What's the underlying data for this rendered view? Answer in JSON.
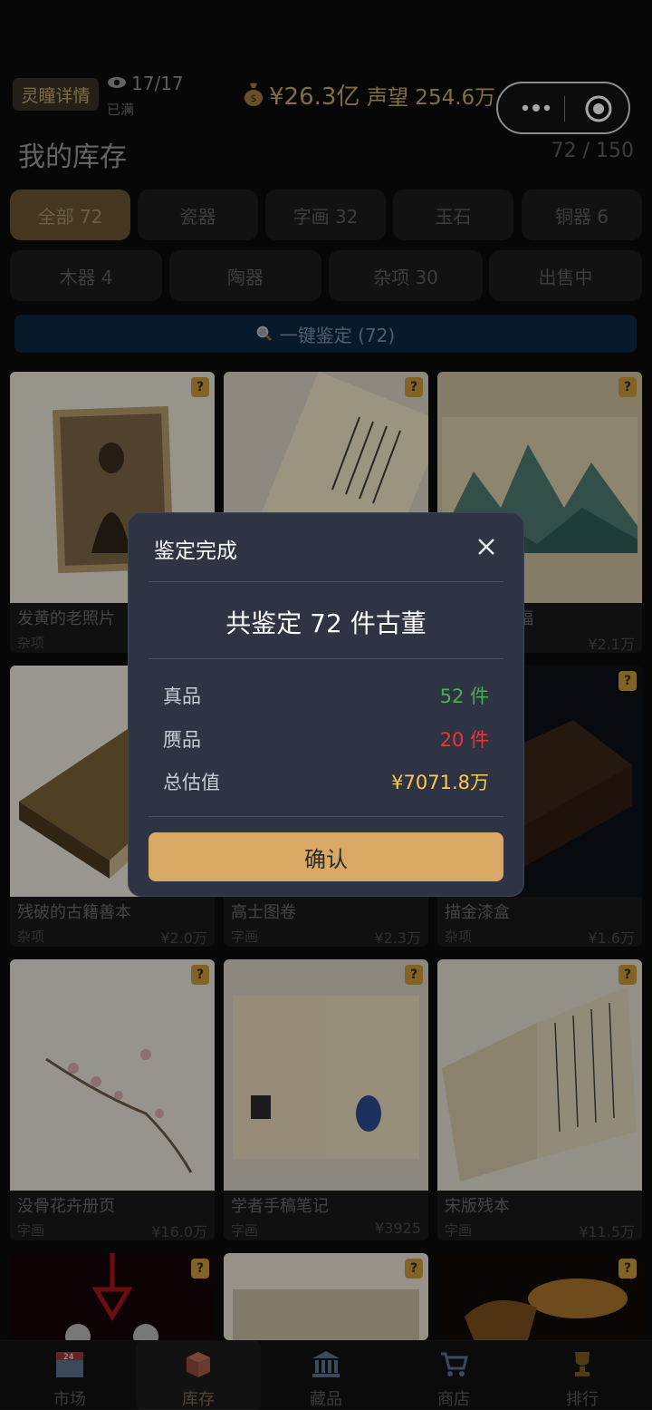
{
  "header": {
    "tag_label": "灵瞳详情",
    "views": "17/17",
    "views_sub": "已满",
    "money": "¥26.3亿",
    "reputation": "声望 254.6万"
  },
  "inventory": {
    "title": "我的库存",
    "count": "72 / 150"
  },
  "tabs_row1": [
    {
      "label": "全部 72",
      "active": true
    },
    {
      "label": "瓷器"
    },
    {
      "label": "字画 32"
    },
    {
      "label": "玉石"
    },
    {
      "label": "铜器 6"
    }
  ],
  "tabs_row2": [
    {
      "label": "木器 4"
    },
    {
      "label": "陶器"
    },
    {
      "label": "杂项 30"
    },
    {
      "label": "出售中"
    }
  ],
  "identify_all": {
    "icon": "search-icon",
    "label": "一键鉴定 (72)"
  },
  "items": [
    {
      "name": "发黄的老照片",
      "category": "杂项",
      "price": "",
      "badge": "?"
    },
    {
      "name": "",
      "category": "",
      "price": "",
      "badge": "?"
    },
    {
      "name": "幅",
      "category": "",
      "price": "¥2.1万",
      "badge": "?"
    },
    {
      "name": "残破的古籍善本",
      "category": "杂项",
      "price": "¥2.0万",
      "badge": "?"
    },
    {
      "name": "高士图卷",
      "category": "字画",
      "price": "¥2.3万",
      "badge": "?"
    },
    {
      "name": "描金漆盒",
      "category": "杂项",
      "price": "¥1.6万",
      "badge": "?"
    },
    {
      "name": "没骨花卉册页",
      "category": "字画",
      "price": "¥16.0万",
      "badge": "?"
    },
    {
      "name": "学者手稿笔记",
      "category": "字画",
      "price": "¥3925",
      "badge": "?"
    },
    {
      "name": "宋版残本",
      "category": "字画",
      "price": "¥11.5万",
      "badge": "?"
    },
    {
      "name": "",
      "category": "",
      "price": "",
      "badge": "?"
    },
    {
      "name": "",
      "category": "",
      "price": "",
      "badge": "?"
    },
    {
      "name": "",
      "category": "",
      "price": "",
      "badge": "?"
    }
  ],
  "modal": {
    "title": "鉴定完成",
    "headline": "共鉴定 72 件古董",
    "rows": [
      {
        "label": "真品",
        "value": "52 件",
        "color": "#4caf50"
      },
      {
        "label": "赝品",
        "value": "20 件",
        "color": "#e53935"
      },
      {
        "label": "总估值",
        "value": "¥7071.8万",
        "color": "#ffc94d"
      }
    ],
    "confirm_label": "确认"
  },
  "bottom_nav": [
    {
      "label": "市场",
      "icon": "calendar-icon",
      "badge": "24"
    },
    {
      "label": "库存",
      "icon": "box-icon",
      "active": true
    },
    {
      "label": "藏品",
      "icon": "museum-icon"
    },
    {
      "label": "商店",
      "icon": "cart-icon"
    },
    {
      "label": "排行",
      "icon": "trophy-icon"
    }
  ],
  "colors": {
    "accent": "#d9a865",
    "modal_bg": "#2e3444",
    "authentic": "#4caf50",
    "fake": "#e53935",
    "value": "#ffc94d"
  }
}
